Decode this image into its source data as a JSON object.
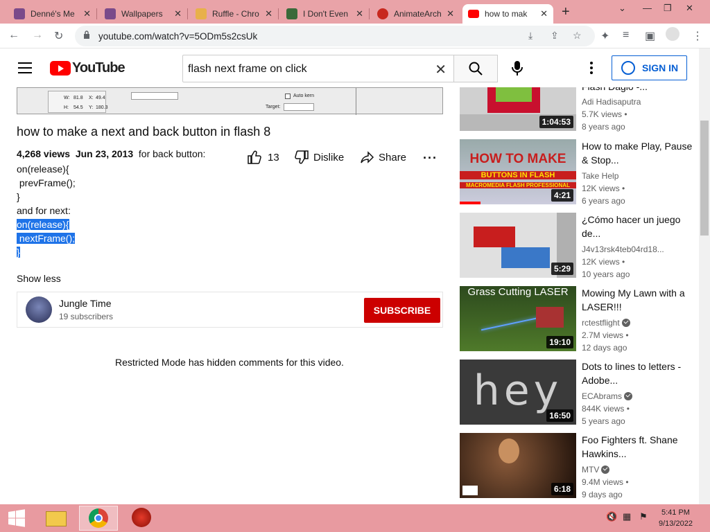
{
  "browser": {
    "tabs": [
      {
        "label": "Denné's Me",
        "icon": "scratch-icon"
      },
      {
        "label": "Wallpapers",
        "icon": "scratch-icon"
      },
      {
        "label": "Ruffle - Chro",
        "icon": "ruffle-icon"
      },
      {
        "label": "I Don't Even",
        "icon": "game-icon"
      },
      {
        "label": "AnimateArch",
        "icon": "flash-icon"
      },
      {
        "label": "how to mak",
        "icon": "youtube-icon",
        "active": true
      }
    ],
    "url": "youtube.com/watch?v=5ODm5s2csUk"
  },
  "youtube": {
    "logo_text": "YouTube",
    "search_query": "flash next frame on click",
    "signin_label": "SIGN IN"
  },
  "video": {
    "title": "how to make a next and back button in flash 8",
    "views": "4,268 views",
    "date": "Jun 23, 2013",
    "desc_intro": "for back button:",
    "desc_lines": [
      "on(release){",
      " prevFrame();",
      "}",
      "and for next:"
    ],
    "desc_highlighted": [
      "on(release){",
      " nextFrame();",
      "}"
    ],
    "likes": "13",
    "dislike_label": "Dislike",
    "share_label": "Share",
    "show_less": "Show less",
    "restricted_notice": "Restricted Mode has hidden comments for this video."
  },
  "channel": {
    "name": "Jungle Time",
    "subscribers": "19 subscribers",
    "subscribe_label": "SUBSCRIBE"
  },
  "flash_panel": {
    "w_label": "W:",
    "w_value": "81.8",
    "h_label": "H:",
    "h_value": "54.5",
    "x_label": "X:",
    "x_value": "49.4",
    "y_label": "Y:",
    "y_value": "180.3",
    "autokern": "Auto kern",
    "target": "Target:"
  },
  "recommendations": [
    {
      "title": "Flash Dagio -...",
      "channel": "Adi Hadisaputra",
      "views": "5.7K views •",
      "age": "8 years ago",
      "duration": "1:04:53",
      "verified": false
    },
    {
      "title": "How to make Play, Pause & Stop...",
      "channel": "Take Help",
      "views": "12K views •",
      "age": "6 years ago",
      "duration": "4:21",
      "verified": false,
      "thumb_text": [
        "HOW TO MAKE",
        "BUTTONS IN FLASH",
        "MACROMEDIA FLASH PROFESSIONAL"
      ]
    },
    {
      "title": "¿Cómo hacer un juego de...",
      "channel": "J4v13rsk4teb04rd18...",
      "views": "12K views •",
      "age": "10 years ago",
      "duration": "5:29",
      "verified": false
    },
    {
      "title": "Mowing My Lawn with a LASER!!!",
      "channel": "rctestflight",
      "views": "2.7M views •",
      "age": "12 days ago",
      "duration": "19:10",
      "verified": true,
      "thumb_text": [
        "Grass Cutting LASER"
      ]
    },
    {
      "title": "Dots to lines to letters - Adobe...",
      "channel": "ECAbrams",
      "views": "844K views •",
      "age": "5 years ago",
      "duration": "16:50",
      "verified": true,
      "thumb_text": [
        "hey"
      ]
    },
    {
      "title": "Foo Fighters ft. Shane Hawkins...",
      "channel": "MTV",
      "views": "9.4M views •",
      "age": "9 days ago",
      "duration": "6:18",
      "verified": true
    }
  ],
  "taskbar": {
    "time": "5:41 PM",
    "date": "9/13/2022"
  }
}
